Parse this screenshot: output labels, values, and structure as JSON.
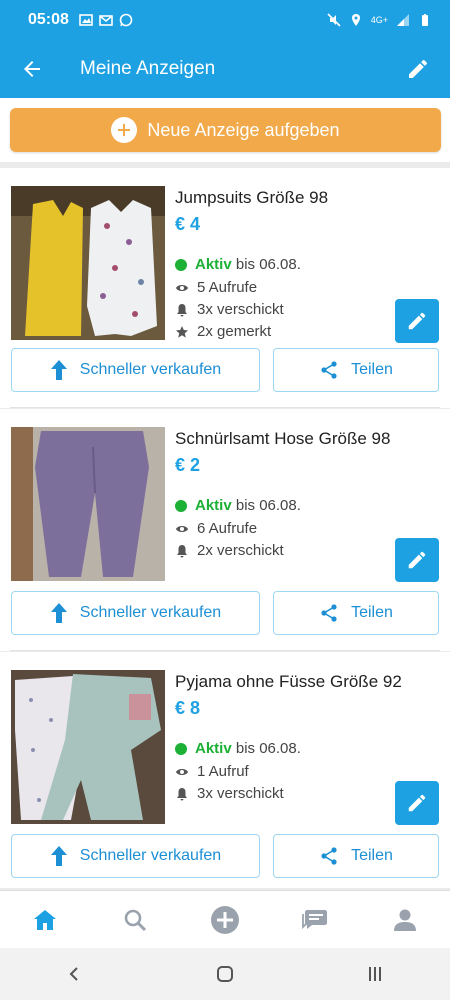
{
  "status_bar": {
    "time": "05:08",
    "network": "4G+"
  },
  "app_bar": {
    "title": "Meine Anzeigen"
  },
  "new_ad_button": {
    "label": "Neue Anzeige aufgeben"
  },
  "ads": [
    {
      "title": "Jumpsuits Größe 98",
      "price": "€ 4",
      "status": "Aktiv",
      "until": "bis 06.08.",
      "views": "5 Aufrufe",
      "sent": "3x verschickt",
      "saved": "2x gemerkt",
      "boost_label": "Schneller verkaufen",
      "share_label": "Teilen"
    },
    {
      "title": "Schnürlsamt Hose Größe 98",
      "price": "€ 2",
      "status": "Aktiv",
      "until": "bis 06.08.",
      "views": "6 Aufrufe",
      "sent": "2x verschickt",
      "boost_label": "Schneller verkaufen",
      "share_label": "Teilen"
    },
    {
      "title": "Pyjama ohne Füsse Größe 92",
      "price": "€ 8",
      "status": "Aktiv",
      "until": "bis 06.08.",
      "views": "1 Aufruf",
      "sent": "3x verschickt",
      "boost_label": "Schneller verkaufen",
      "share_label": "Teilen"
    }
  ],
  "bottom_nav": [
    "home-icon",
    "search-icon",
    "add-icon",
    "messages-icon",
    "profile-icon"
  ],
  "colors": {
    "primary": "#1da1e2",
    "accent": "#f2a94a",
    "active": "#1cb035"
  }
}
